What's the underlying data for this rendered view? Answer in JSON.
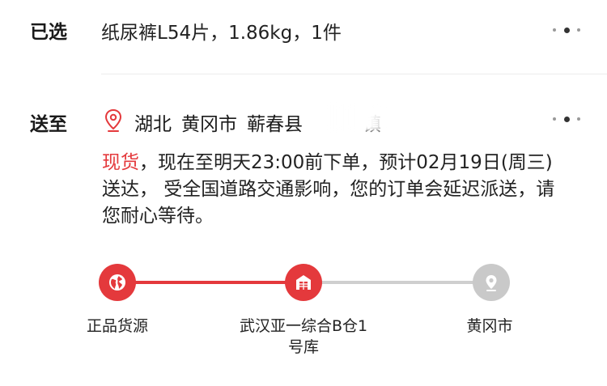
{
  "selected": {
    "label": "已选",
    "value": "纸尿裤L54片，1.86kg，1件"
  },
  "delivery": {
    "label": "送至",
    "address_parts": [
      "湖北",
      "黄冈市",
      "蕲春县",
      "镇"
    ],
    "stock_tag": "现货",
    "description": "，现在至明天23:00前下单，预计02月19日(周三)送达， 受全国道路交通影响，您的订单会延迟派送，请您耐心等待。"
  },
  "progress": {
    "steps": [
      {
        "label": "正品货源",
        "icon": "globe-icon",
        "state": "done"
      },
      {
        "label": "武汉亚一综合B仓1号库",
        "icon": "warehouse-icon",
        "state": "done"
      },
      {
        "label": "黄冈市",
        "icon": "location-pin-icon",
        "state": "pending"
      }
    ]
  },
  "colors": {
    "accent": "#e4393c",
    "pending": "#c9c9c9",
    "text": "#222222"
  }
}
